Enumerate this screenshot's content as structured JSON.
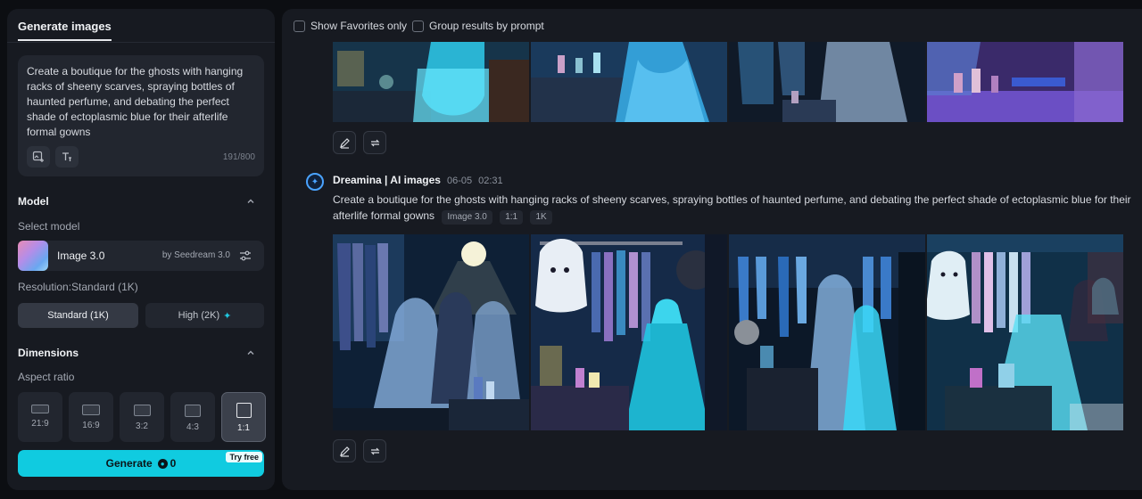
{
  "left_panel": {
    "tab": "Generate images",
    "prompt": {
      "text": "Create a boutique for the ghosts with hanging racks of sheeny scarves, spraying bottles of haunted perfume, and debating the perfect shade of ectoplasmic blue for their afterlife formal gowns",
      "count": "191/800"
    },
    "model_section": {
      "title": "Model",
      "select_label": "Select model",
      "model_name": "Image 3.0",
      "model_by": "by Seedream 3.0",
      "resolution_label": "Resolution:Standard (1K)",
      "res_standard": "Standard (1K)",
      "res_high": "High (2K)"
    },
    "dimensions": {
      "title": "Dimensions",
      "aspect_label": "Aspect ratio",
      "ratios": [
        "21:9",
        "16:9",
        "3:2",
        "4:3",
        "1:1"
      ],
      "selected": "1:1"
    },
    "generate": {
      "label": "Generate",
      "cost": "0",
      "badge": "Try free"
    }
  },
  "right_panel": {
    "filters": {
      "favorites": "Show Favorites only",
      "group": "Group results by prompt"
    },
    "result": {
      "author": "Dreamina | AI images",
      "date": "06-05",
      "time": "02:31",
      "prompt": "Create a boutique for the ghosts with hanging racks of sheeny scarves, spraying bottles of haunted perfume, and debating the perfect shade of ectoplasmic blue for their afterlife formal gowns",
      "tags": [
        "Image 3.0",
        "1:1",
        "1K"
      ]
    }
  },
  "colors": {
    "accent": "#10cbe0",
    "panel": "#171a21",
    "background": "#0c0e12"
  }
}
